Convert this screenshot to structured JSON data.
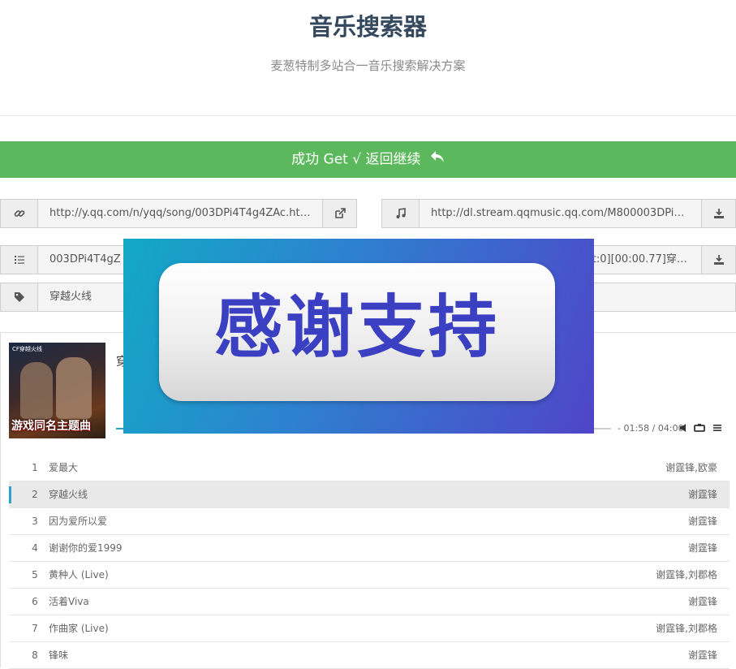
{
  "header": {
    "title": "音乐搜索器",
    "subtitle": "麦葱特制多站合一音乐搜索解决方案"
  },
  "success_bar": {
    "label": "成功 Get √ 返回继续",
    "icon": "reply-arrow-icon",
    "color": "#5cb85c"
  },
  "fields": {
    "link": {
      "icon": "link-icon",
      "value": "http://y.qq.com/n/yqq/song/003DPi4T4g4ZAc.html",
      "action_icon": "external-link-icon"
    },
    "audio": {
      "icon": "music-note-icon",
      "value": "http://dl.stream.qqmusic.qq.com/M800003DPi4T4 ...",
      "action_icon": "download-icon"
    },
    "lyric_id": {
      "icon": "list-icon",
      "value": "003DPi4T4gZ"
    },
    "lyric": {
      "value": "set:0][00:00.77]穿 ...",
      "action_icon": "download-icon"
    },
    "name": {
      "icon": "tag-icon",
      "value": "穿越火线"
    }
  },
  "player": {
    "cover_text": "游戏同名主题曲",
    "cover_logo": "CF穿越火线",
    "title_partial": "穿",
    "time": "- 01:58 / 04:00",
    "progress": 0.06,
    "accent": "#2aa3c9"
  },
  "playlist": [
    {
      "num": "1",
      "name": "爱最大",
      "artist": "谢霆锋,欧豪"
    },
    {
      "num": "2",
      "name": "穿越火线",
      "artist": "谢霆锋",
      "active": true
    },
    {
      "num": "3",
      "name": "因为爱所以爱",
      "artist": "谢霆锋"
    },
    {
      "num": "4",
      "name": "谢谢你的爱1999",
      "artist": "谢霆锋"
    },
    {
      "num": "5",
      "name": "黄种人 (Live)",
      "artist": "谢霆锋,刘郡格"
    },
    {
      "num": "6",
      "name": "活着Viva",
      "artist": "谢霆锋"
    },
    {
      "num": "7",
      "name": "作曲家 (Live)",
      "artist": "谢霆锋,刘郡格"
    },
    {
      "num": "8",
      "name": "锋味",
      "artist": "谢霆锋"
    }
  ],
  "overlay": {
    "text": "感谢支持"
  }
}
